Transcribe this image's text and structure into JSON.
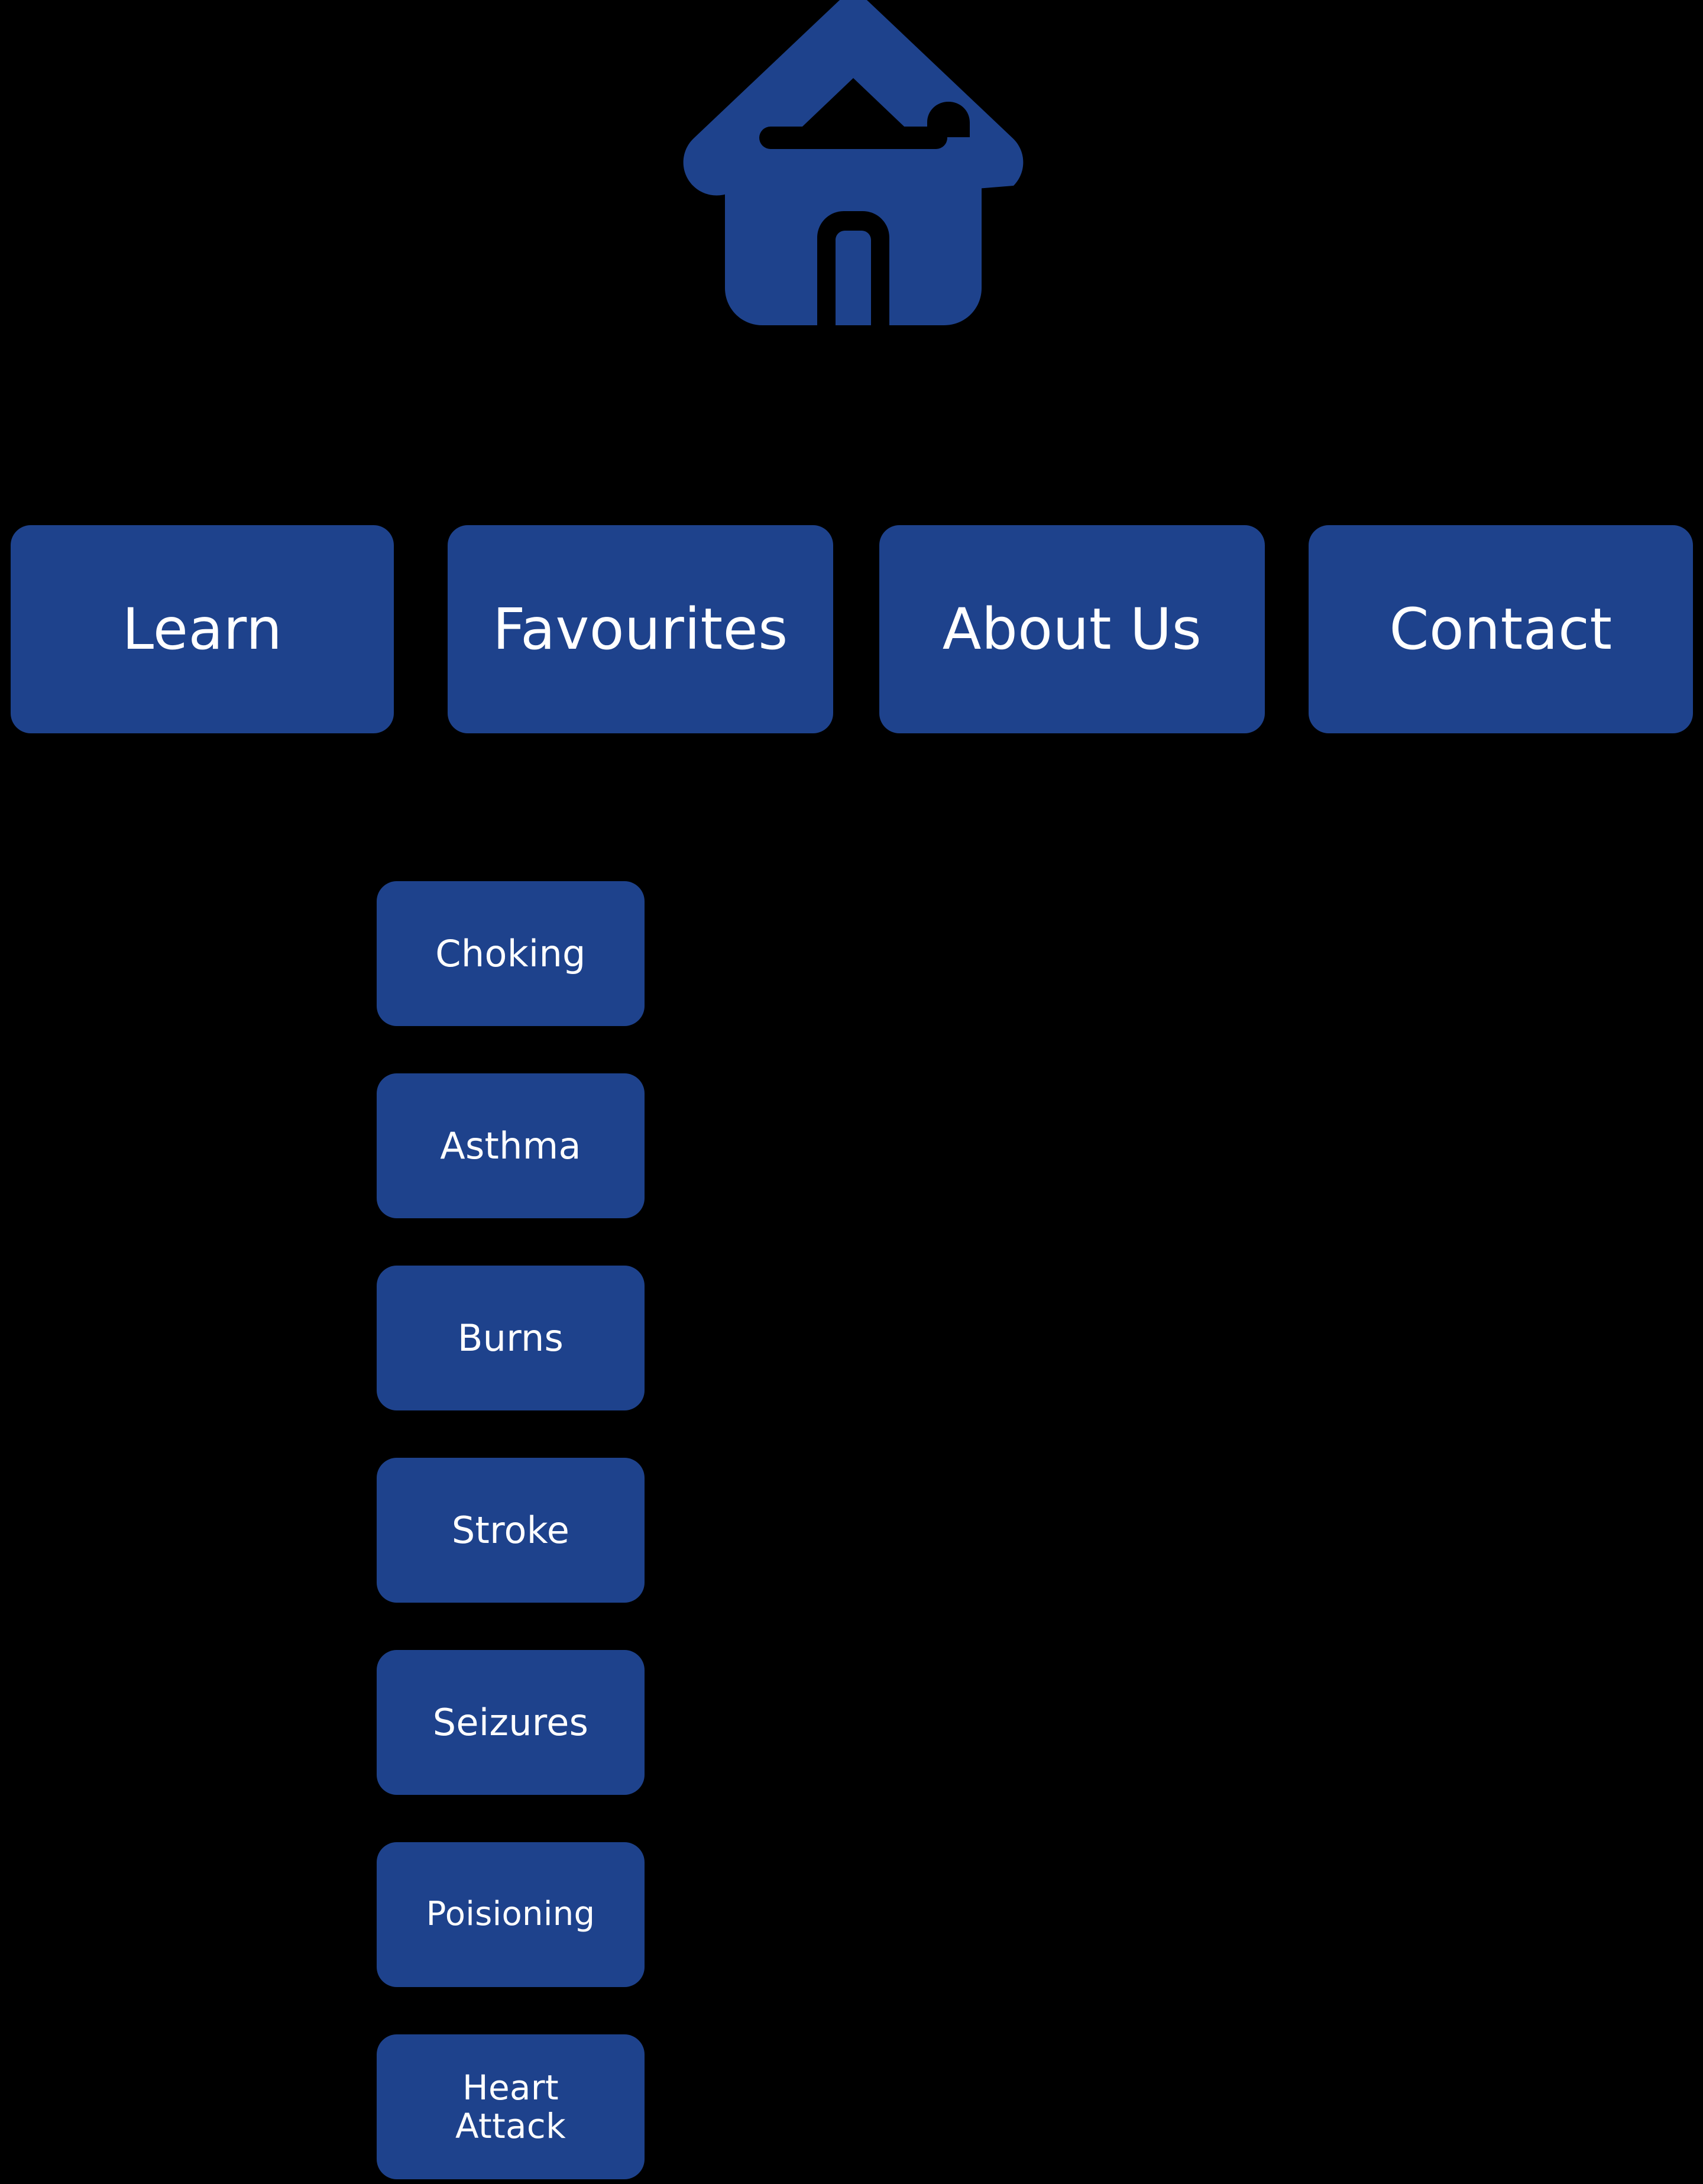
{
  "theme": {
    "background": "#000000",
    "accent_blue": "#1E428C",
    "text_on_accent": "#FFFFFF"
  },
  "logo": {
    "icon": "home-icon",
    "label": "Home"
  },
  "nav": {
    "items": [
      {
        "id": "learn",
        "label": "Learn"
      },
      {
        "id": "favourites",
        "label": "Favourites"
      },
      {
        "id": "about-us",
        "label": "About Us"
      },
      {
        "id": "contact",
        "label": "Contact"
      }
    ]
  },
  "submenu": {
    "parent": "Learn",
    "items": [
      {
        "id": "choking",
        "label": "Choking"
      },
      {
        "id": "asthma",
        "label": "Asthma"
      },
      {
        "id": "burns",
        "label": "Burns"
      },
      {
        "id": "stroke",
        "label": "Stroke"
      },
      {
        "id": "seizures",
        "label": "Seizures"
      },
      {
        "id": "poisioning",
        "label": "Poisioning"
      },
      {
        "id": "heart-attack",
        "label": "Heart\nAttack"
      }
    ]
  }
}
